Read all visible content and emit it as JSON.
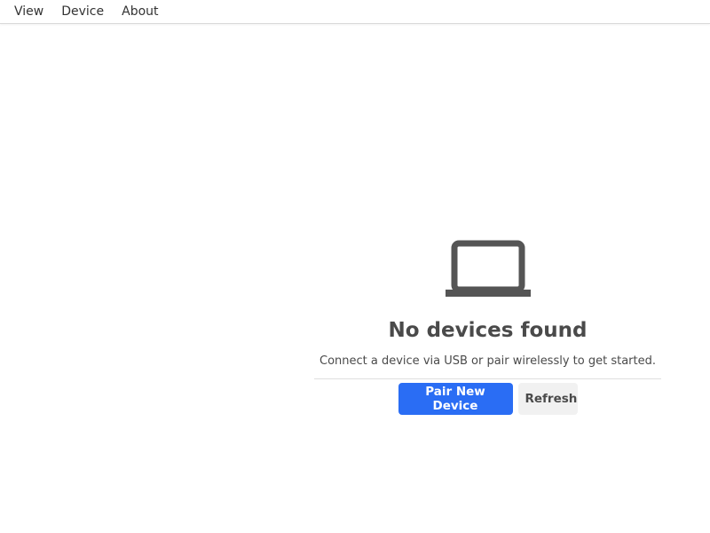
{
  "menubar": {
    "items": [
      "View",
      "Device",
      "About"
    ]
  },
  "empty_state": {
    "icon": "laptop-icon",
    "title": "No devices found",
    "message": "Connect a device via USB or pair wirelessly to get started.",
    "primary_button": "Pair New Device",
    "secondary_button": "Refresh"
  },
  "colors": {
    "accent": "#2a6df4",
    "text": "#4a4a4a",
    "icon": "#555555",
    "secondary_button_bg": "#f1f1f1"
  }
}
